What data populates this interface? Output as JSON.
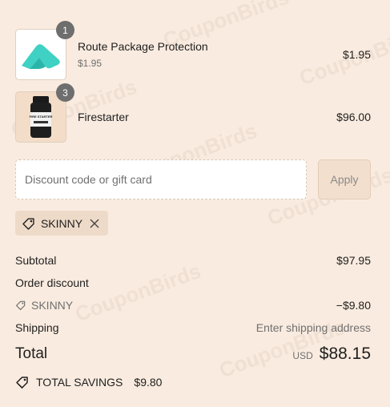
{
  "watermark": "CouponBirds",
  "items": [
    {
      "name": "Route Package Protection",
      "subtitle": "$1.95",
      "price": "$1.95",
      "quantity": "1",
      "image": "route-logo"
    },
    {
      "name": "Firestarter",
      "subtitle": "",
      "price": "$96.00",
      "quantity": "3",
      "image": "supplement-bottle"
    }
  ],
  "bottle_label": "FIRE STARTER",
  "discount": {
    "placeholder": "Discount code or gift card",
    "value": "",
    "apply_label": "Apply"
  },
  "applied_code": {
    "code": "SKINNY"
  },
  "summary": {
    "subtotal_label": "Subtotal",
    "subtotal_value": "$97.95",
    "order_discount_label": "Order discount",
    "discount_code": "SKINNY",
    "discount_value": "−$9.80",
    "shipping_label": "Shipping",
    "shipping_value": "Enter shipping address",
    "total_label": "Total",
    "currency": "USD",
    "total_value": "$88.15"
  },
  "savings": {
    "label": "TOTAL SAVINGS",
    "value": "$9.80"
  },
  "colors": {
    "background": "#f9ebdf",
    "route_teal": "#3fd1c3",
    "badge": "#6e6e6e",
    "chip": "#eedac8"
  }
}
